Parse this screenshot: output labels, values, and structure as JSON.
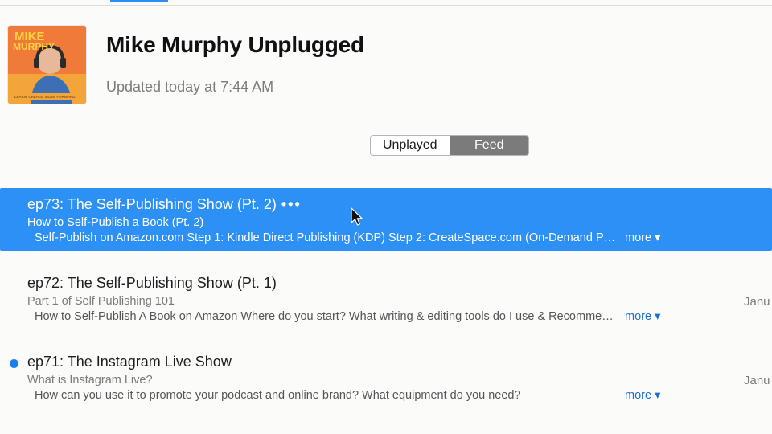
{
  "podcast": {
    "title": "Mike Murphy Unplugged",
    "updated": "Updated today at 7:44 AM",
    "artwork": {
      "top_text_1": "MIKE",
      "top_text_2": "MURPHY",
      "footer_text": "LEARN, CREATE, MOVE FORWARD.",
      "background_color": "#f07a3a"
    }
  },
  "segmented_control": {
    "options": [
      "Unplayed",
      "Feed"
    ],
    "selected": "Feed"
  },
  "episodes": [
    {
      "title": "ep73: The Self-Publishing Show (Pt. 2)",
      "menu_glyph": "•••",
      "subtitle": "How to Self-Publish a Book (Pt. 2)",
      "description": "Self-Publish on Amazon.com  Step 1: Kindle Direct Publishing (KDP)  Step 2: CreateSpace.com (On-Demand Print)",
      "more": "more ▾",
      "date": "",
      "unplayed": false,
      "selected": true
    },
    {
      "title": "ep72: The Self-Publishing Show (Pt. 1)",
      "subtitle": "Part 1 of Self Publishing 101",
      "description": "How to Self-Publish A Book on Amazon  Where do you start?  What writing & editing tools do I use & Recommend?",
      "more": "more ▾",
      "date": "Janu",
      "unplayed": false,
      "selected": false
    },
    {
      "title": "ep71: The Instagram Live Show",
      "subtitle": "What is Instagram Live?",
      "description": "How can you use it to promote your podcast and online brand? What equipment do you need?",
      "more": "more ▾",
      "date": "Janu",
      "unplayed": true,
      "selected": false
    }
  ],
  "colors": {
    "selection": "#2c90f4",
    "link": "#1b6fd1",
    "unplayed_dot": "#1d7cf2"
  }
}
